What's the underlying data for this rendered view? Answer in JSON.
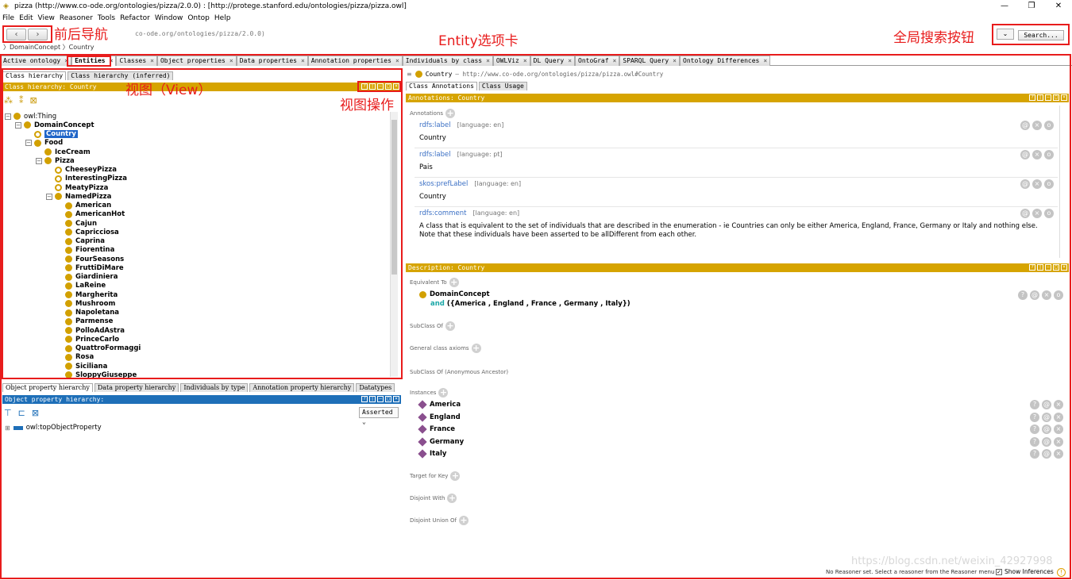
{
  "window": {
    "title": "pizza (http://www.co-ode.org/ontologies/pizza/2.0.0)  : [http://protege.stanford.edu/ontologies/pizza/pizza.owl]",
    "controls": [
      "—",
      "❐",
      "✕"
    ]
  },
  "menu": [
    "File",
    "Edit",
    "View",
    "Reasoner",
    "Tools",
    "Refactor",
    "Window",
    "Ontop",
    "Help"
  ],
  "nav": {
    "back": "‹",
    "forward": "›",
    "url": "co-ode.org/ontologies/pizza/2.0.0)",
    "breadcrumb": "〉DomainConcept 〉Country",
    "search_label": "Search...",
    "dropdown": "⌄"
  },
  "annotations_overlay": {
    "nav": "前后导航",
    "entity_tab": "Entity选项卡",
    "global_search": "全局搜索按钮",
    "view": "视图（View）",
    "view_ops": "视图操作"
  },
  "tabs": [
    {
      "label": "Active ontology",
      "active": false
    },
    {
      "label": "Entities",
      "active": true
    },
    {
      "label": "Classes",
      "active": false
    },
    {
      "label": "Object properties",
      "active": false
    },
    {
      "label": "Data properties",
      "active": false
    },
    {
      "label": "Annotation properties",
      "active": false
    },
    {
      "label": "Individuals by class",
      "active": false
    },
    {
      "label": "OWLViz",
      "active": false
    },
    {
      "label": "DL Query",
      "active": false
    },
    {
      "label": "OntoGraf",
      "active": false
    },
    {
      "label": "SPARQL Query",
      "active": false
    },
    {
      "label": "Ontology Differences",
      "active": false
    }
  ],
  "left_top": {
    "subtabs": [
      "Class hierarchy",
      "Class hierarchy (inferred)"
    ],
    "header": "Class hierarchy: Country",
    "toolbar_icons": [
      "add-subclass-icon",
      "add-sibling-icon",
      "delete-class-icon"
    ],
    "tree": [
      {
        "label": "owl:Thing",
        "depth": 0,
        "toggle": "−",
        "style": "plain"
      },
      {
        "label": "DomainConcept",
        "depth": 1,
        "toggle": "−",
        "style": "bold"
      },
      {
        "label": "Country",
        "depth": 2,
        "toggle": "",
        "style": "selected",
        "ring": true
      },
      {
        "label": "Food",
        "depth": 2,
        "toggle": "−",
        "style": "bold"
      },
      {
        "label": "IceCream",
        "depth": 3,
        "toggle": "",
        "style": "bold"
      },
      {
        "label": "Pizza",
        "depth": 3,
        "toggle": "−",
        "style": "bold"
      },
      {
        "label": "CheeseyPizza",
        "depth": 4,
        "toggle": "",
        "style": "bold",
        "ring": true
      },
      {
        "label": "InterestingPizza",
        "depth": 4,
        "toggle": "",
        "style": "bold",
        "ring": true
      },
      {
        "label": "MeatyPizza",
        "depth": 4,
        "toggle": "",
        "style": "bold",
        "ring": true
      },
      {
        "label": "NamedPizza",
        "depth": 4,
        "toggle": "−",
        "style": "bold"
      },
      {
        "label": "American",
        "depth": 5,
        "toggle": "",
        "style": "bold"
      },
      {
        "label": "AmericanHot",
        "depth": 5,
        "toggle": "",
        "style": "bold"
      },
      {
        "label": "Cajun",
        "depth": 5,
        "toggle": "",
        "style": "bold"
      },
      {
        "label": "Capricciosa",
        "depth": 5,
        "toggle": "",
        "style": "bold"
      },
      {
        "label": "Caprina",
        "depth": 5,
        "toggle": "",
        "style": "bold"
      },
      {
        "label": "Fiorentina",
        "depth": 5,
        "toggle": "",
        "style": "bold"
      },
      {
        "label": "FourSeasons",
        "depth": 5,
        "toggle": "",
        "style": "bold"
      },
      {
        "label": "FruttiDiMare",
        "depth": 5,
        "toggle": "",
        "style": "bold"
      },
      {
        "label": "Giardiniera",
        "depth": 5,
        "toggle": "",
        "style": "bold"
      },
      {
        "label": "LaReine",
        "depth": 5,
        "toggle": "",
        "style": "bold"
      },
      {
        "label": "Margherita",
        "depth": 5,
        "toggle": "",
        "style": "bold"
      },
      {
        "label": "Mushroom",
        "depth": 5,
        "toggle": "",
        "style": "bold"
      },
      {
        "label": "Napoletana",
        "depth": 5,
        "toggle": "",
        "style": "bold"
      },
      {
        "label": "Parmense",
        "depth": 5,
        "toggle": "",
        "style": "bold"
      },
      {
        "label": "PolloAdAstra",
        "depth": 5,
        "toggle": "",
        "style": "bold"
      },
      {
        "label": "PrinceCarlo",
        "depth": 5,
        "toggle": "",
        "style": "bold"
      },
      {
        "label": "QuattroFormaggi",
        "depth": 5,
        "toggle": "",
        "style": "bold"
      },
      {
        "label": "Rosa",
        "depth": 5,
        "toggle": "",
        "style": "bold"
      },
      {
        "label": "Siciliana",
        "depth": 5,
        "toggle": "",
        "style": "bold"
      },
      {
        "label": "SloppyGiuseppe",
        "depth": 5,
        "toggle": "",
        "style": "bold"
      }
    ]
  },
  "left_bottom": {
    "subtabs": [
      "Object property hierarchy",
      "Data property hierarchy",
      "Individuals by type",
      "Annotation property hierarchy",
      "Datatypes"
    ],
    "header": "Object property hierarchy:",
    "assert_label": "Asserted",
    "root": "owl:topObjectProperty"
  },
  "right": {
    "entity_label": "Country",
    "entity_iri": "— http://www.co-ode.org/ontologies/pizza/pizza.owl#Country",
    "subtabs": [
      "Class Annotations",
      "Class Usage"
    ],
    "annotations_header": "Annotations: Country",
    "annotations_title": "Annotations",
    "annotations": [
      {
        "prop": "rdfs:label",
        "lang": "[language: en]",
        "value": "Country"
      },
      {
        "prop": "rdfs:label",
        "lang": "[language: pt]",
        "value": "Pais"
      },
      {
        "prop": "skos:prefLabel",
        "lang": "[language: en]",
        "value": "Country"
      },
      {
        "prop": "rdfs:comment",
        "lang": "[language: en]",
        "value": "A class that is equivalent to the set of individuals that are described in the enumeration - ie Countries can only be either America, England, France, Germany or Italy and nothing else. Note that these individuals have been asserted to be allDifferent from each other."
      }
    ],
    "description_header": "Description: Country",
    "equivalent_to": "Equivalent To",
    "equiv_class": "DomainConcept",
    "equiv_and": "and",
    "equiv_expr": "({America , England , France , Germany , Italy})",
    "subclass_of": "SubClass Of",
    "general_axioms": "General class axioms",
    "subclass_anon": "SubClass Of (Anonymous Ancestor)",
    "instances_title": "Instances",
    "instances": [
      "America",
      "England",
      "France",
      "Germany",
      "Italy"
    ],
    "target_for_key": "Target for Key",
    "disjoint_with": "Disjoint With",
    "disjoint_union_of": "Disjoint Union Of"
  },
  "status": {
    "reasoner": "No Reasoner set. Select a reasoner from the Reasoner menu",
    "show_inferences": "Show Inferences",
    "watermark": "https://blog.csdn.net/weixin_42927998"
  }
}
